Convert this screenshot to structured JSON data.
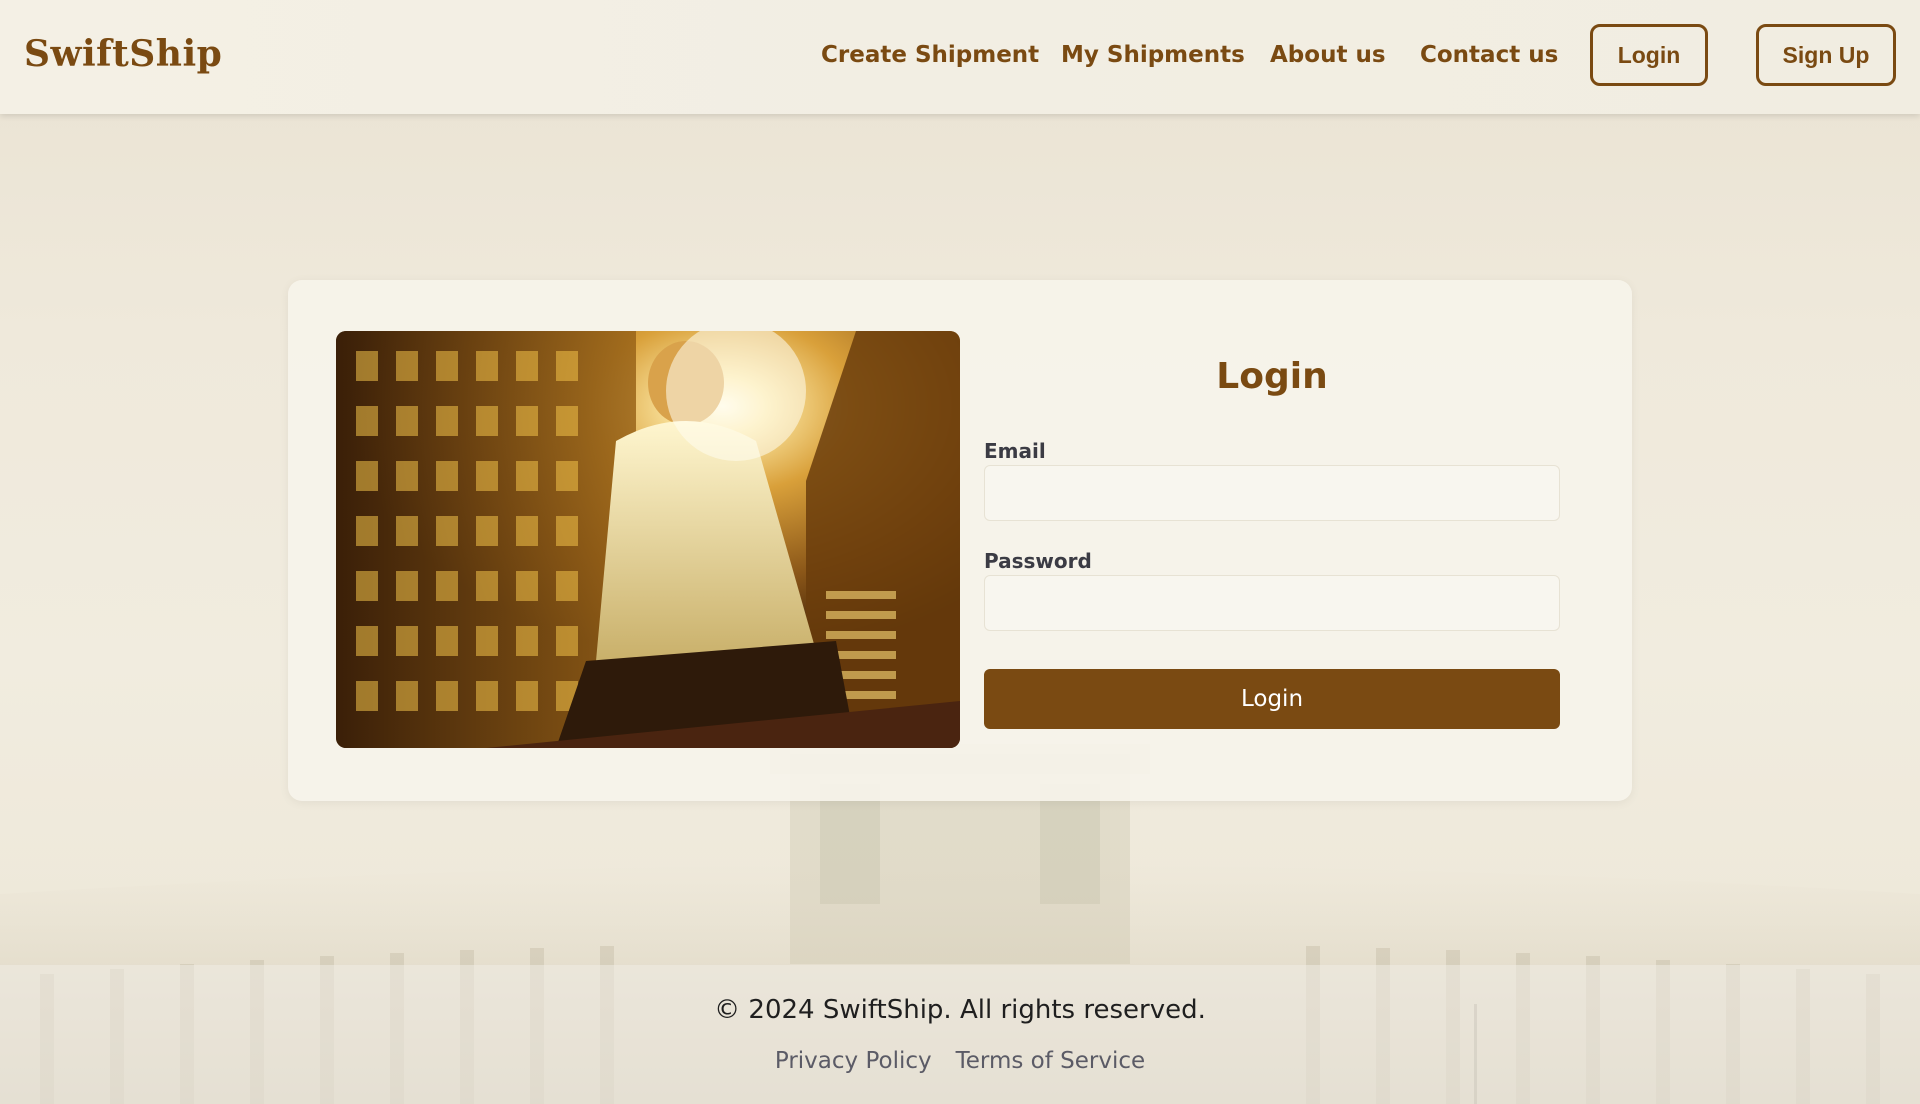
{
  "brand": {
    "name": "SwiftShip"
  },
  "nav": {
    "links": [
      {
        "label": "Create Shipment"
      },
      {
        "label": "My Shipments"
      },
      {
        "label": "About us"
      },
      {
        "label": "Contact us"
      }
    ],
    "login_label": "Login",
    "signup_label": "Sign Up"
  },
  "login_form": {
    "title": "Login",
    "email_label": "Email",
    "email_value": "",
    "password_label": "Password",
    "password_value": "",
    "submit_label": "Login"
  },
  "footer": {
    "copyright": "© 2024 SwiftShip. All rights reserved.",
    "links": [
      {
        "label": "Privacy Policy"
      },
      {
        "label": "Terms of Service"
      }
    ]
  },
  "colors": {
    "brand": "#7a4a12",
    "background": "#efe9db",
    "card": "#f6f3ea",
    "footer_text": "#1f1f1f",
    "footer_link": "#5b5b66"
  },
  "icons": {
    "hero_image": "man-sitting-city-sunset-photo"
  }
}
